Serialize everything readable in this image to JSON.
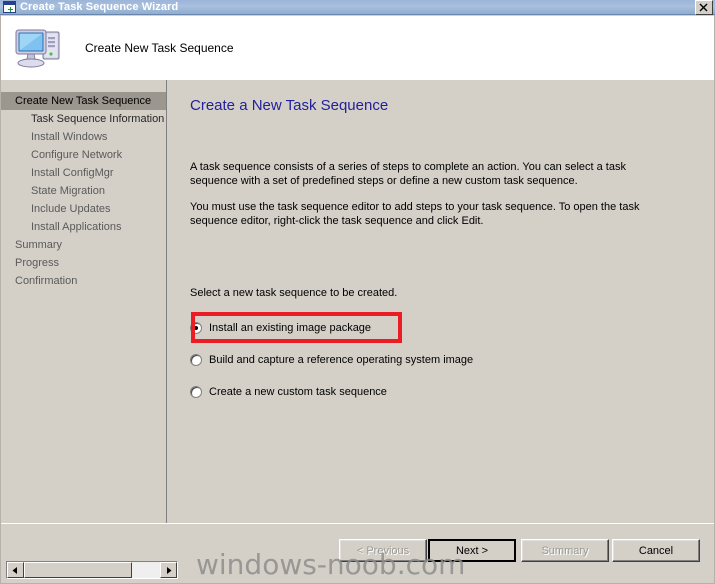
{
  "window": {
    "title": "Create Task Sequence Wizard",
    "title_icon": "wizard-window-plus-icon",
    "close_label": "×"
  },
  "header": {
    "title": "Create New Task Sequence",
    "icon": "computer-monitor-icon"
  },
  "sidebar": {
    "items": [
      {
        "label": "Create New Task Sequence",
        "level": 0,
        "state": "selected"
      },
      {
        "label": "Task Sequence Information",
        "level": 1,
        "state": "current"
      },
      {
        "label": "Install Windows",
        "level": 1,
        "state": "normal"
      },
      {
        "label": "Configure Network",
        "level": 1,
        "state": "normal"
      },
      {
        "label": "Install ConfigMgr",
        "level": 1,
        "state": "normal"
      },
      {
        "label": "State Migration",
        "level": 1,
        "state": "normal"
      },
      {
        "label": "Include Updates",
        "level": 1,
        "state": "normal"
      },
      {
        "label": "Install Applications",
        "level": 1,
        "state": "normal"
      },
      {
        "label": "Summary",
        "level": 0,
        "state": "normal"
      },
      {
        "label": "Progress",
        "level": 0,
        "state": "normal"
      },
      {
        "label": "Confirmation",
        "level": 0,
        "state": "normal"
      }
    ]
  },
  "content": {
    "page_title": "Create a New Task Sequence",
    "paragraph_1": "A task sequence consists of a series of steps to complete an action. You can select a task sequence with a set of predefined steps or define a new custom task sequence.",
    "paragraph_2": "You must use the task sequence editor to add steps to your task sequence. To open the task sequence editor, right-click the task sequence and click Edit.",
    "prompt": "Select a new task sequence to be created.",
    "options": [
      {
        "label": "Install an existing image package",
        "checked": true,
        "highlighted": true
      },
      {
        "label": "Build and capture a reference operating system image",
        "checked": false,
        "highlighted": false
      },
      {
        "label": "Create a new custom task sequence",
        "checked": false,
        "highlighted": false
      }
    ],
    "highlight_color": "#ec1c24"
  },
  "footer": {
    "previous_label": "< Previous",
    "next_label": "Next >",
    "summary_label": "Summary",
    "cancel_label": "Cancel"
  },
  "watermark": {
    "text": "windows-noob.com"
  },
  "scrollbar": {
    "left_arrow": "◀",
    "right_arrow": "▶"
  },
  "colors": {
    "titlebar_start": "#9cb5d8",
    "titlebar_end": "#8faccf",
    "dialog_face": "#d4d0c8",
    "page_title": "#21219b",
    "selected_nav": "#9b968e"
  }
}
